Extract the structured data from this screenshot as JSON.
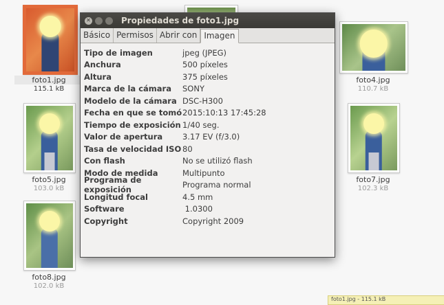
{
  "dialog": {
    "title": "Propiedades de foto1.jpg",
    "tabs": [
      "Básico",
      "Permisos",
      "Abrir con",
      "Imagen"
    ],
    "active_tab": "Imagen",
    "properties": [
      {
        "key": "Tipo de imagen",
        "value": "jpeg (JPEG)"
      },
      {
        "key": "Anchura",
        "value": "500 píxeles"
      },
      {
        "key": "Altura",
        "value": "375 píxeles"
      },
      {
        "key": "Marca de la cámara",
        "value": "SONY"
      },
      {
        "key": "Modelo de la cámara",
        "value": "DSC-H300"
      },
      {
        "key": "Fecha en que se tomó",
        "value": "2015:10:13 17:45:28"
      },
      {
        "key": "Tiempo de exposición",
        "value": "1/40 seg."
      },
      {
        "key": "Valor de apertura",
        "value": "3.17 EV (f/3.0)"
      },
      {
        "key": "Tasa de velocidad ISO",
        "value": "80"
      },
      {
        "key": "Con flash",
        "value": "No se utilizó flash"
      },
      {
        "key": "Modo de medida",
        "value": "Multipunto"
      },
      {
        "key": "Programa de exposición",
        "value": "Programa normal"
      },
      {
        "key": "Longitud focal",
        "value": "4.5 mm"
      },
      {
        "key": "Software",
        "value": " 1.0300"
      },
      {
        "key": "Copyright",
        "value": "Copyright 2009"
      }
    ]
  },
  "files": [
    {
      "name": "foto1.jpg",
      "size": "115.1 kB",
      "selected": true
    },
    {
      "name": "foto4.jpg",
      "size": "110.7 kB",
      "selected": false
    },
    {
      "name": "foto5.jpg",
      "size": "103.0 kB",
      "selected": false
    },
    {
      "name": "foto7.jpg",
      "size": "102.3 kB",
      "selected": false
    },
    {
      "name": "foto8.jpg",
      "size": "102.0 kB",
      "selected": false
    }
  ],
  "tooltip": "foto1.jpg - 115.1 kB"
}
